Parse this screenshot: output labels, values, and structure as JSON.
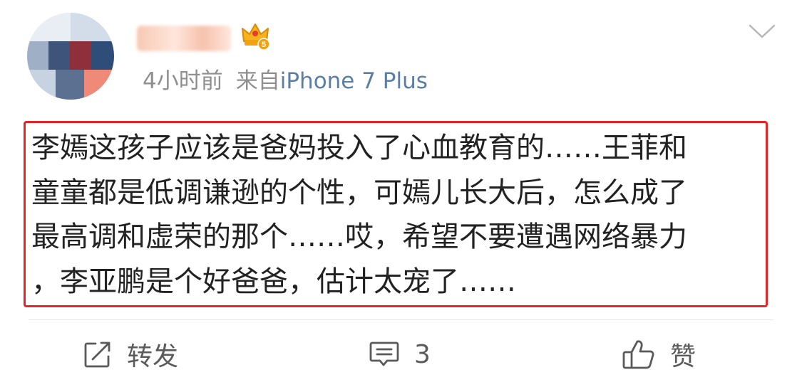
{
  "post": {
    "time": "4小时前",
    "source_prefix": "来自",
    "device": "iPhone 7 Plus",
    "body_lines": [
      "李嫣这孩子应该是爸妈投入了心血教育的……王菲和",
      "童童都是低调谦逊的个性，可嫣儿长大后，怎么成了",
      "最高调和虚荣的那个……哎，希望不要遭遇网络暴力",
      "，李亚鹏是个好爸爸，估计太宠了……"
    ],
    "vip_level": "5"
  },
  "actions": {
    "repost_label": "转发",
    "comment_count": "3",
    "like_label": "赞"
  },
  "icons": {
    "vip": "crown-vip-icon",
    "more": "chevron-down-icon",
    "repost": "repost-icon",
    "comment": "comment-icon",
    "like": "thumbs-up-icon"
  },
  "colors": {
    "highlight_border": "#e2262a",
    "source_link": "#5b7ea6",
    "meta_gray": "#8f8f8f",
    "vip_gold": "#f3a20e"
  }
}
